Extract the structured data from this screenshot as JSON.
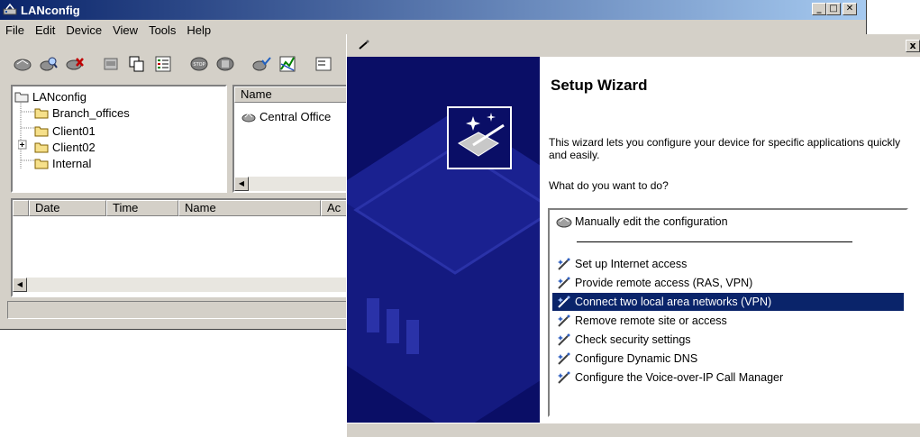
{
  "main_window": {
    "title": "LANconfig",
    "menu": [
      "File",
      "Edit",
      "Device",
      "View",
      "Tools",
      "Help"
    ],
    "tree": {
      "root": "LANconfig",
      "children": [
        "Branch_offices",
        "Client01",
        "Client02",
        "Internal"
      ]
    },
    "list": {
      "column": "Name",
      "items": [
        "Central Office"
      ]
    },
    "log_columns": [
      "Date",
      "Time",
      "Name",
      "Ac"
    ]
  },
  "wizard": {
    "heading": "Setup Wizard",
    "intro": "This wizard lets you configure your device for specific applications quickly and easily.",
    "prompt": "What do you want to do?",
    "manual_option": "Manually edit the configuration",
    "options": [
      "Set up Internet access",
      "Provide remote access (RAS, VPN)",
      "Connect two local area networks (VPN)",
      "Remove remote site or access",
      "Check security settings",
      "Configure Dynamic DNS",
      "Configure the Voice-over-IP Call Manager"
    ],
    "selected_index": 2,
    "close_label": "x"
  },
  "colors": {
    "titlebar_start": "#0a246a",
    "titlebar_end": "#a6caf0",
    "selection": "#0a246a",
    "wizard_banner": "#0a0e66",
    "window_face": "#d4d0c8"
  }
}
